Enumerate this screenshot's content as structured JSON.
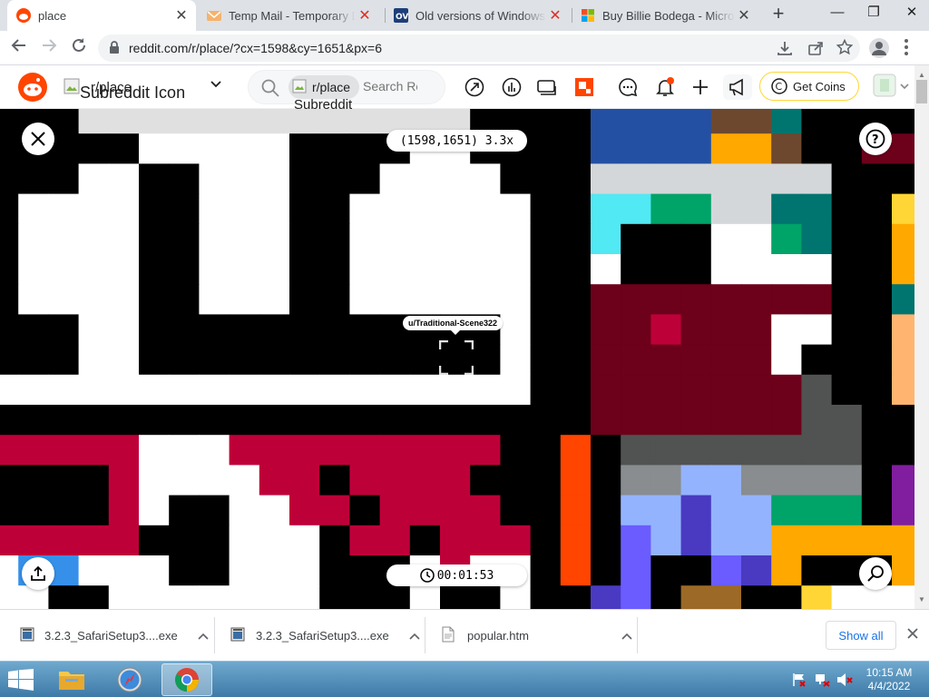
{
  "browser": {
    "tabs": [
      {
        "title": "place",
        "active": true,
        "icon": "reddit-icon"
      },
      {
        "title": "Temp Mail - Temporary Disposable Email",
        "active": false,
        "icon": "envelope-icon"
      },
      {
        "title": "Old versions of Windows, Mac",
        "active": false,
        "icon": "ov-icon"
      },
      {
        "title": "Buy Billie Bodega - Microsoft",
        "active": false,
        "icon": "microsoft-icon"
      }
    ],
    "url": "reddit.com/r/place/?cx=1598&cy=1651&px=6"
  },
  "reddit": {
    "subreddit_icon_alt": "Subreddit Icon",
    "subreddit_chip": "r/place",
    "search_icon_alt": "Subreddit Icon",
    "search_placeholder": "Search Reddit",
    "get_coins": "Get Coins"
  },
  "place": {
    "coordinates": "(1598,1651) 3.3x",
    "username": "u/Traditional-Scene322",
    "timer": "00:01:53"
  },
  "downloads": {
    "items": [
      {
        "name": "3.2.3_SafariSetup3....exe"
      },
      {
        "name": "3.2.3_SafariSetup3....exe"
      },
      {
        "name": "popular.htm"
      }
    ],
    "show_all": "Show all"
  },
  "taskbar": {
    "time": "10:15 AM",
    "date": "4/4/2022"
  },
  "colors": {
    "reddit_orange": "#ff4500",
    "taskbar_blue": "#4a8ab8",
    "palette": {
      "k": "#000000",
      "w": "#ffffff",
      "g": "#e0e0e0",
      "r": "#6d001a",
      "R": "#be0039",
      "o": "#ff4500",
      "y": "#ffa800",
      "Y": "#ffd635",
      "b": "#2450a4",
      "B": "#3690ea",
      "c": "#51e9f4",
      "C": "#00ccc0",
      "t": "#00756f",
      "G": "#00a368",
      "l": "#7eed56",
      "p": "#811e9f",
      "P": "#b44ac0",
      "s": "#ffb470",
      "n": "#6d482f",
      "N": "#9c6926",
      "d": "#515252",
      "D": "#898d90",
      "m": "#d4d7d9",
      "v": "#6a5cff",
      "V": "#94b3ff",
      "u": "#493ac1",
      "x": "#e4abff"
    }
  }
}
